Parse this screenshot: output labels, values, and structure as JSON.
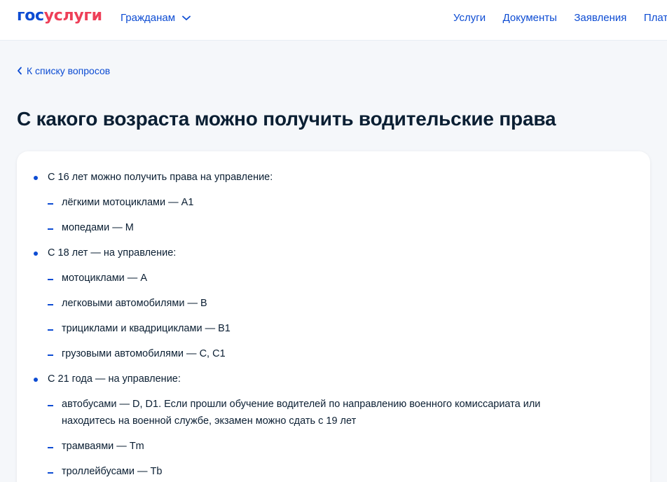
{
  "header": {
    "logo_part1": "гос",
    "logo_part2": "услуги",
    "audience_label": "Гражданам",
    "nav": [
      "Услуги",
      "Документы",
      "Заявления",
      "Платежи"
    ]
  },
  "back_link": "К списку вопросов",
  "page_title": "С какого возраста можно получить водительские права",
  "content": {
    "groups": [
      {
        "heading": "С 16 лет можно получить права на управление:",
        "items": [
          "лёгкими мотоциклами — А1",
          "мопедами — М"
        ]
      },
      {
        "heading": "С 18 лет — на управление:",
        "items": [
          "мотоциклами — А",
          "легковыми автомобилями — В",
          "трициклами и квадрициклами — В1",
          "грузовыми автомобилями — С, С1"
        ]
      },
      {
        "heading": "С 21 года — на управление:",
        "items": [
          "автобусами — D, D1. Если прошли обучение водителей по направлению военного комиссариата или находитесь на военной службе, экзамен можно сдать с 19 лет",
          "трамваями — Tm",
          "троллейбусами — Tb"
        ]
      }
    ]
  },
  "colors": {
    "brand_blue": "#0d4cd3",
    "brand_red": "#ee3f58",
    "text": "#0b1f33"
  }
}
